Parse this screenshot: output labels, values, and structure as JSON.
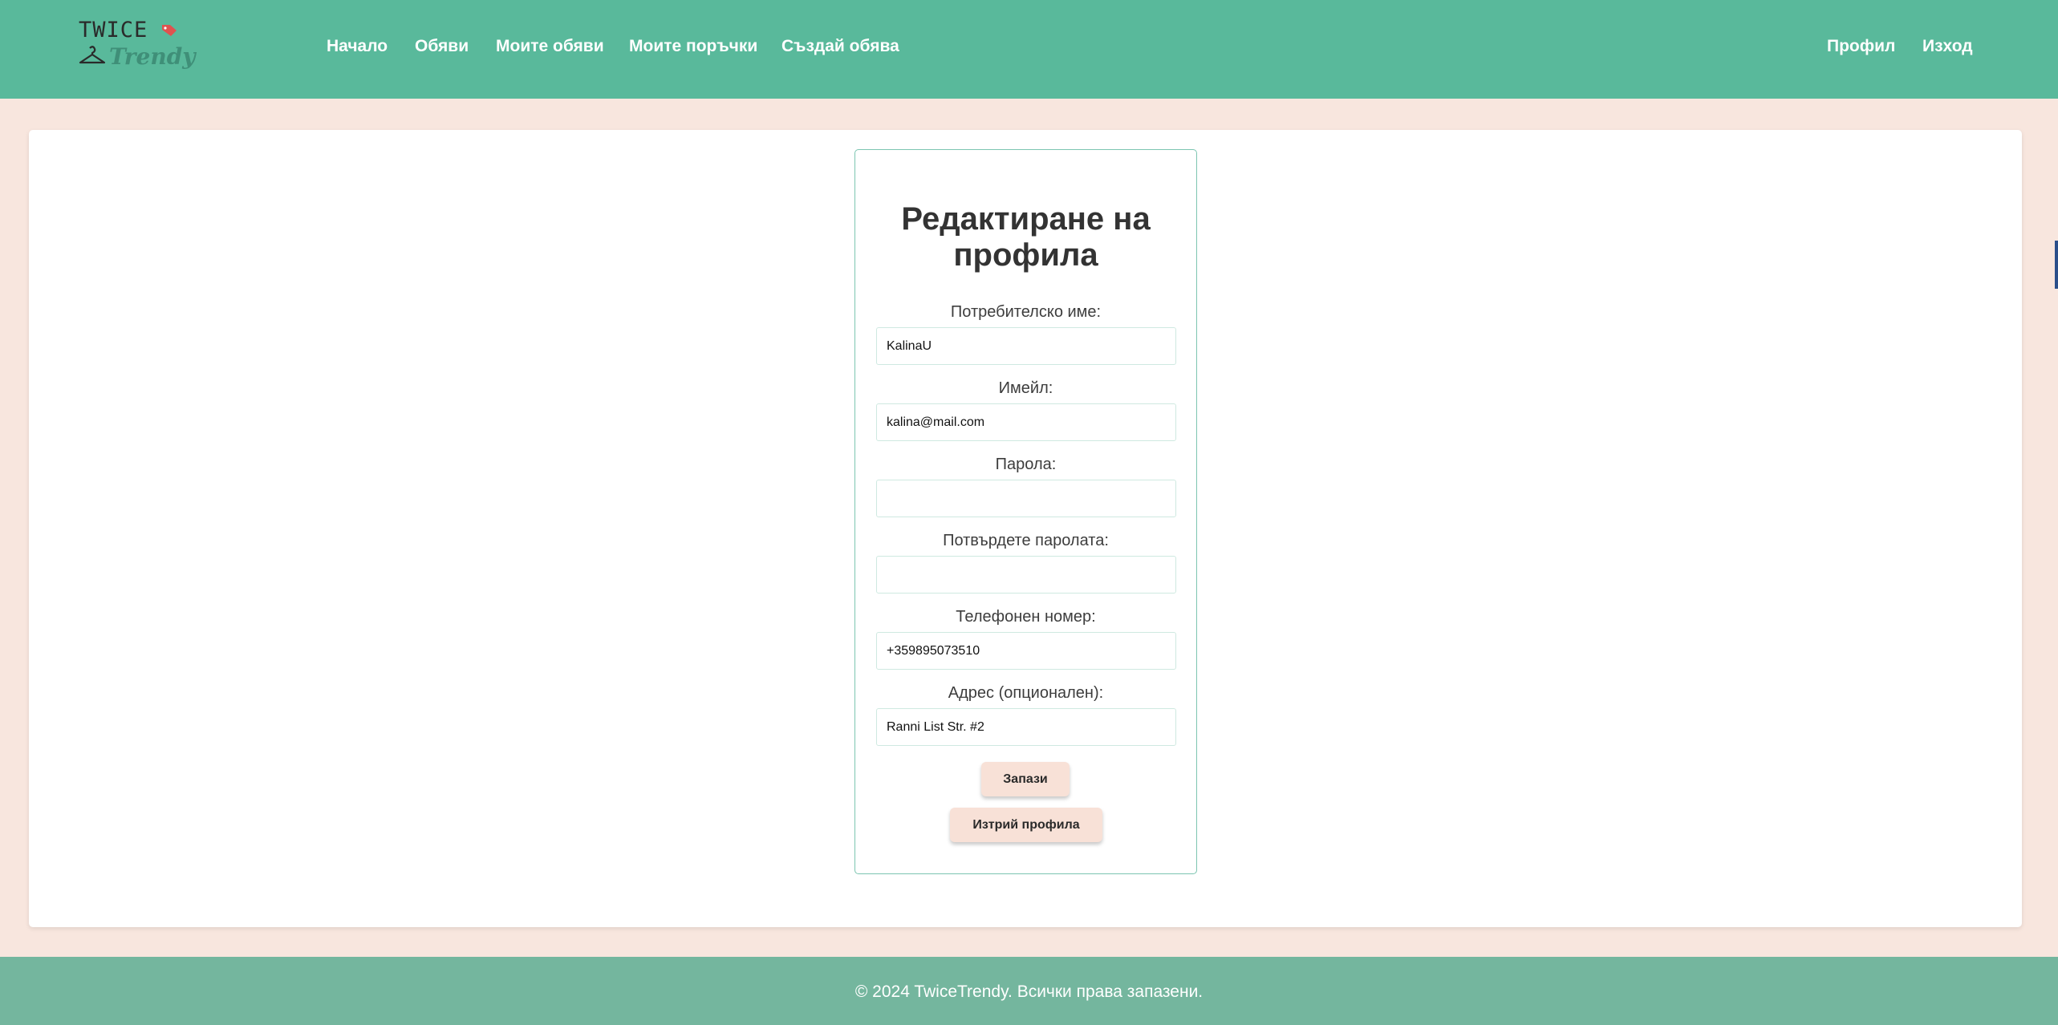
{
  "brand": {
    "logo_top": "TWICE",
    "logo_bottom": "Trendy",
    "primary_color": "#59b99b",
    "background_color": "#f8e6de"
  },
  "nav": {
    "home": "Начало",
    "listings": "Обяви",
    "my_listings": "Моите обяви",
    "my_orders": "Моите поръчки",
    "create_listing": "Създай обява",
    "profile": "Профил",
    "logout": "Изход"
  },
  "form": {
    "title": "Редактиране на профила",
    "username_label": "Потребителско име:",
    "username_value": "KalinaU",
    "email_label": "Имейл:",
    "email_value": "kalina@mail.com",
    "password_label": "Парола:",
    "password_value": "",
    "confirm_password_label": "Потвърдете паролата:",
    "confirm_password_value": "",
    "phone_label": "Телефонен номер:",
    "phone_value": "+359895073510",
    "address_label": "Адрес (опционален):",
    "address_value": "Ranni List Str. #2",
    "save_label": "Запази",
    "delete_label": "Изтрий профила"
  },
  "footer": {
    "text": "© 2024 TwiceTrendy. Всички права запазени."
  }
}
